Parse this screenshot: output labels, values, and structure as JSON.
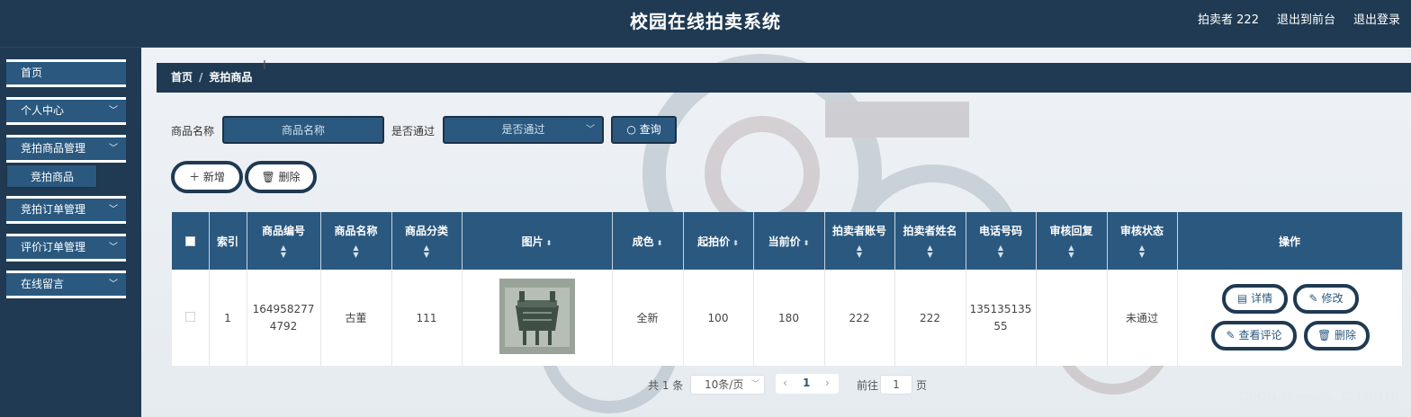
{
  "header": {
    "title": "校园在线拍卖系统",
    "user": "拍卖者 222",
    "front_link": "退出到前台",
    "logout": "退出登录"
  },
  "sidebar": {
    "items": [
      {
        "label": "首页"
      },
      {
        "label": "个人中心"
      },
      {
        "label": "竞拍商品管理"
      },
      {
        "label": "竞拍订单管理"
      },
      {
        "label": "评价订单管理"
      },
      {
        "label": "在线留言"
      }
    ],
    "sub_item": "竞拍商品"
  },
  "breadcrumb": {
    "home": "首页",
    "separator": "/",
    "current": "竞拍商品"
  },
  "search": {
    "name_label": "商品名称",
    "name_placeholder": "商品名称",
    "pass_label": "是否通过",
    "pass_placeholder": "是否通过",
    "query_button": "查询"
  },
  "actions": {
    "add": "新增",
    "delete": "删除"
  },
  "table": {
    "columns": [
      "索引",
      "商品编号",
      "商品名称",
      "商品分类",
      "图片",
      "成色",
      "起拍价",
      "当前价",
      "拍卖者账号",
      "拍卖者姓名",
      "电话号码",
      "审核回复",
      "审核状态",
      "操作"
    ],
    "rows": [
      {
        "index": "1",
        "code": "1649582774792",
        "name": "古董",
        "category": "111",
        "condition": "全新",
        "start_price": "100",
        "current_price": "180",
        "account": "222",
        "seller_name": "222",
        "phone": "13513513555",
        "reply": "",
        "status": "未通过"
      }
    ],
    "row_actions": {
      "detail": "详情",
      "edit": "修改",
      "comments": "查看评论",
      "delete": "删除"
    }
  },
  "pagination": {
    "total": "共 1 条",
    "page_size": "10条/页",
    "current_page": "1",
    "goto_label": "前往",
    "goto_value": "1",
    "page_suffix": "页"
  },
  "watermark": "CSDN @weixin_72790115",
  "colors": {
    "header": "#1f3a52",
    "accent": "#2a587f",
    "table_header": "#2a587f"
  }
}
